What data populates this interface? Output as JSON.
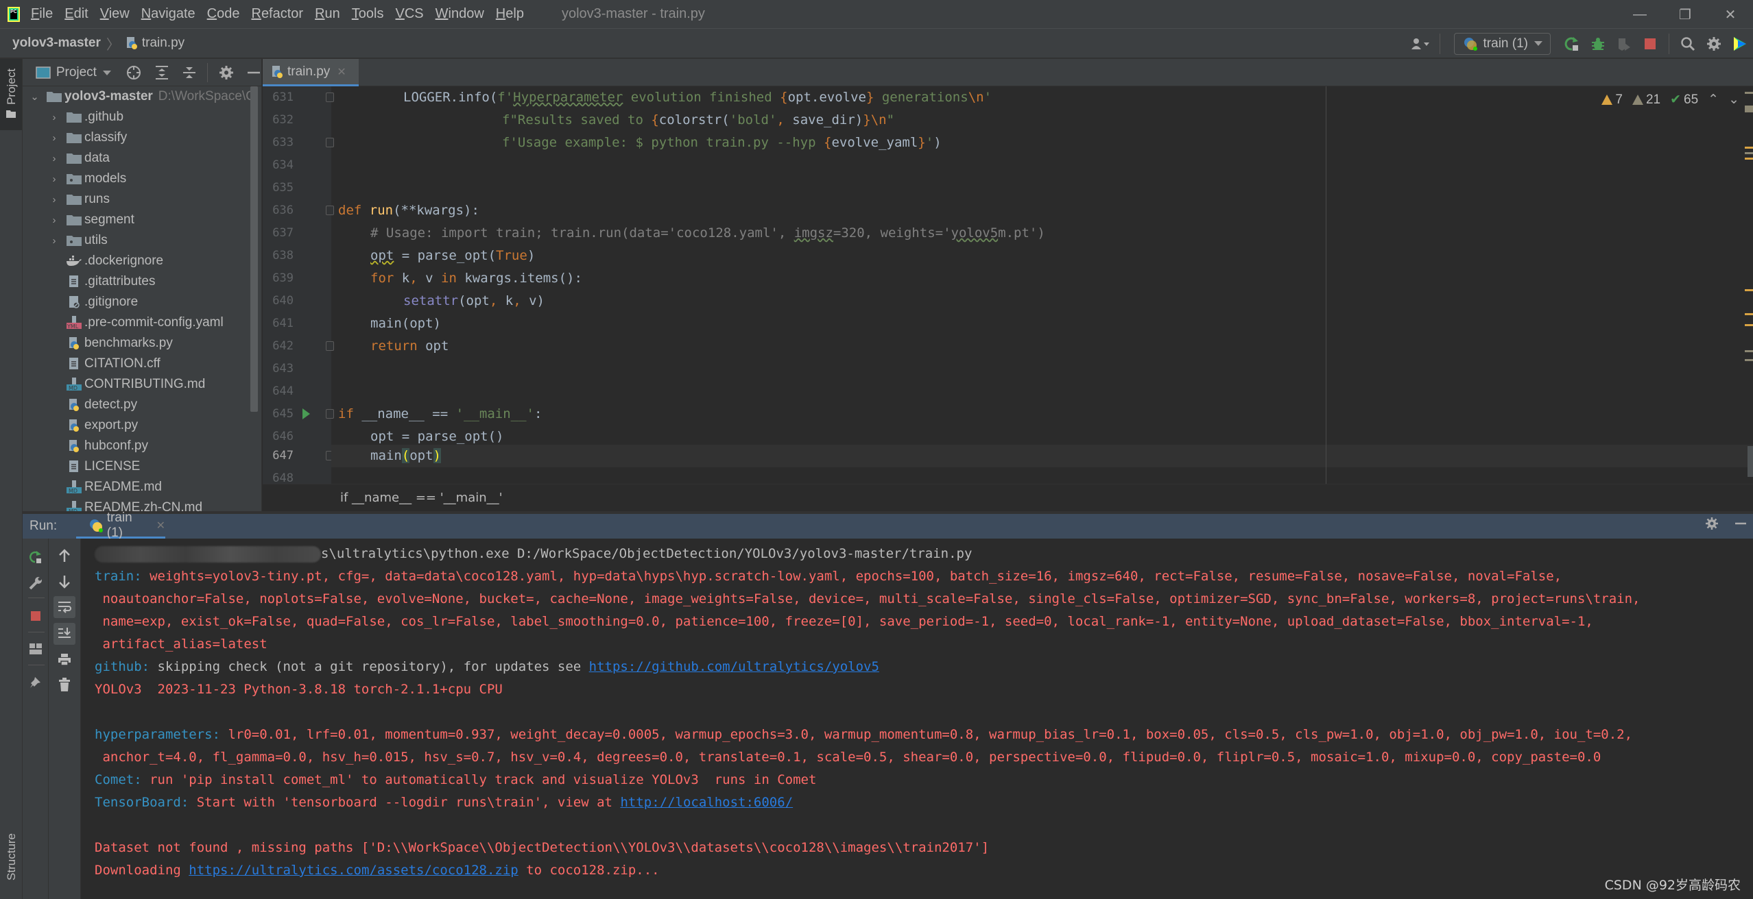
{
  "app": {
    "logo_text": "PC",
    "window_title": "yolov3-master - train.py",
    "menu": [
      {
        "label": "File",
        "mnemonic": "F",
        "rest": "ile"
      },
      {
        "label": "Edit",
        "mnemonic": "E",
        "rest": "dit"
      },
      {
        "label": "View",
        "mnemonic": "V",
        "rest": "iew"
      },
      {
        "label": "Navigate",
        "mnemonic": "N",
        "rest": "avigate"
      },
      {
        "label": "Code",
        "mnemonic": "C",
        "rest": "ode"
      },
      {
        "label": "Refactor",
        "mnemonic": "R",
        "rest": "efactor"
      },
      {
        "label": "Run",
        "mnemonic": "R",
        "rest": "un"
      },
      {
        "label": "Tools",
        "mnemonic": "T",
        "rest": "ools"
      },
      {
        "label": "VCS",
        "mnemonic": "V",
        "rest": "CS"
      },
      {
        "label": "Window",
        "mnemonic": "W",
        "rest": "indow"
      },
      {
        "label": "Help",
        "mnemonic": "H",
        "rest": "elp"
      }
    ],
    "window_controls": {
      "minimize": "—",
      "restore": "❐",
      "close": "✕"
    }
  },
  "navbar": {
    "project": "yolov3-master",
    "separator": "〉",
    "file": "train.py",
    "run_config": "train (1)"
  },
  "left_stripe": {
    "project_tab": "Project",
    "structure_tab": "Structure"
  },
  "project_panel": {
    "title": "Project",
    "root": {
      "name": "yolov3-master",
      "path": "D:\\WorkSpace\\O"
    },
    "items": [
      {
        "name": ".github",
        "type": "folder",
        "expandable": true
      },
      {
        "name": "classify",
        "type": "folder",
        "expandable": true
      },
      {
        "name": "data",
        "type": "folder",
        "expandable": true
      },
      {
        "name": "models",
        "type": "package",
        "expandable": true
      },
      {
        "name": "runs",
        "type": "folder",
        "expandable": true
      },
      {
        "name": "segment",
        "type": "folder",
        "expandable": true
      },
      {
        "name": "utils",
        "type": "package",
        "expandable": true
      },
      {
        "name": ".dockerignore",
        "type": "docker",
        "expandable": false
      },
      {
        "name": ".gitattributes",
        "type": "text",
        "expandable": false
      },
      {
        "name": ".gitignore",
        "type": "ignore",
        "expandable": false
      },
      {
        "name": ".pre-commit-config.yaml",
        "type": "yaml",
        "expandable": false
      },
      {
        "name": "benchmarks.py",
        "type": "python",
        "expandable": false
      },
      {
        "name": "CITATION.cff",
        "type": "text",
        "expandable": false
      },
      {
        "name": "CONTRIBUTING.md",
        "type": "markdown",
        "expandable": false
      },
      {
        "name": "detect.py",
        "type": "python",
        "expandable": false
      },
      {
        "name": "export.py",
        "type": "python",
        "expandable": false
      },
      {
        "name": "hubconf.py",
        "type": "python",
        "expandable": false
      },
      {
        "name": "LICENSE",
        "type": "text",
        "expandable": false
      },
      {
        "name": "README.md",
        "type": "markdown",
        "expandable": false
      },
      {
        "name": "README.zh-CN.md",
        "type": "markdown",
        "expandable": false
      }
    ]
  },
  "editor": {
    "tab": "train.py",
    "inspections": {
      "warnings": "7",
      "weak_warnings": "21",
      "typos": "65"
    },
    "line_numbers": [
      "631",
      "632",
      "633",
      "634",
      "635",
      "636",
      "637",
      "638",
      "639",
      "640",
      "641",
      "642",
      "643",
      "644",
      "645",
      "646",
      "647",
      "648"
    ],
    "current_line": "647",
    "code": {
      "l631": {
        "a": "LOGGER.info(",
        "b": "f'",
        "c": "Hyperparameter",
        "d": " evolution finished ",
        "e": "{",
        "f": "opt.evolve",
        "g": "}",
        "h": " generations",
        "i": "\\n",
        "j": "'"
      },
      "l632": {
        "a": "f\"Results saved to ",
        "b": "{",
        "c": "colorstr(",
        "d": "'bold'",
        "e": ", ",
        "f": "save_dir)",
        "g": "}",
        "h": "\\n",
        "i": "\""
      },
      "l633": {
        "a": "f'Usage example: $ python train.py --hyp ",
        "b": "{",
        "c": "evolve_yaml",
        "d": "}",
        "e": "'",
        "f": ")"
      },
      "l636": {
        "kw": "def",
        "fn": "run",
        "rest": "(**kwargs):"
      },
      "l637": {
        "a": "# Usage: import train; train.run(data='coco128.yaml', ",
        "b": "imgsz",
        "c": "=320, weights='",
        "d": "yolov5",
        "e": "m.pt')"
      },
      "l638": {
        "a": "opt",
        "b": " = parse_opt(",
        "c": "True",
        "d": ")"
      },
      "l639": {
        "kw1": "for",
        "a": " k",
        "comma1": ",",
        "b": " v ",
        "kw2": "in",
        "c": " kwargs.items():"
      },
      "l640": {
        "bi": "setattr",
        "a": "(opt",
        "c1": ",",
        "b": " k",
        "c2": ",",
        "c": " v)"
      },
      "l641": {
        "a": "main(opt)"
      },
      "l642": {
        "kw": "return",
        "a": " opt"
      },
      "l645": {
        "kw": "if",
        "a": " __name__ == ",
        "str": "'__main__'",
        "b": ":"
      },
      "l646": {
        "a": "opt = parse_opt()"
      },
      "l647": {
        "a": "main",
        "open": "(",
        "b": "opt",
        "close": ")"
      }
    },
    "breadcrumb": "if __name__ == '__main__'"
  },
  "run_panel": {
    "label": "Run:",
    "tab": "train (1)",
    "console": [
      {
        "kind": "cmd",
        "text": "s\\ultralytics\\python.exe D:/WorkSpace/ObjectDetection/YOLOv3/yolov3-master/train.py"
      },
      {
        "kind": "prefixed",
        "prefix": "train:",
        "text": " weights=yolov3-tiny.pt, cfg=, data=data\\coco128.yaml, hyp=data\\hyps\\hyp.scratch-low.yaml, epochs=100, batch_size=16, imgsz=640, rect=False, resume=False, nosave=False, noval=False,"
      },
      {
        "kind": "red",
        "text": " noautoanchor=False, noplots=False, evolve=None, bucket=, cache=None, image_weights=False, device=, multi_scale=False, single_cls=False, optimizer=SGD, sync_bn=False, workers=8, project=runs\\train,"
      },
      {
        "kind": "red",
        "text": " name=exp, exist_ok=False, quad=False, cos_lr=False, label_smoothing=0.0, patience=100, freeze=[0], save_period=-1, seed=0, local_rank=-1, entity=None, upload_dataset=False, bbox_interval=-1,"
      },
      {
        "kind": "red",
        "text": " artifact_alias=latest"
      },
      {
        "kind": "github",
        "prefix": "github:",
        "text": " skipping check (not a git repository), for updates see ",
        "link": "https://github.com/ultralytics/yolov5"
      },
      {
        "kind": "red",
        "text": "YOLOv3  2023-11-23 Python-3.8.18 torch-2.1.1+cpu CPU"
      },
      {
        "kind": "blank",
        "text": ""
      },
      {
        "kind": "prefixed",
        "prefix": "hyperparameters:",
        "text": " lr0=0.01, lrf=0.01, momentum=0.937, weight_decay=0.0005, warmup_epochs=3.0, warmup_momentum=0.8, warmup_bias_lr=0.1, box=0.05, cls=0.5, cls_pw=1.0, obj=1.0, obj_pw=1.0, iou_t=0.2,"
      },
      {
        "kind": "red",
        "text": " anchor_t=4.0, fl_gamma=0.0, hsv_h=0.015, hsv_s=0.7, hsv_v=0.4, degrees=0.0, translate=0.1, scale=0.5, shear=0.0, perspective=0.0, flipud=0.0, fliplr=0.5, mosaic=1.0, mixup=0.0, copy_paste=0.0"
      },
      {
        "kind": "prefixed",
        "prefix": "Comet:",
        "text": " run 'pip install comet_ml' to automatically track and visualize YOLOv3  runs in Comet"
      },
      {
        "kind": "link_line",
        "prefix": "TensorBoard:",
        "text": " Start with 'tensorboard --logdir runs\\train', view at ",
        "link": "http://localhost:6006/"
      },
      {
        "kind": "blank",
        "text": ""
      },
      {
        "kind": "red",
        "text": "Dataset not found , missing paths ['D:\\\\WorkSpace\\\\ObjectDetection\\\\YOLOv3\\\\datasets\\\\coco128\\\\images\\\\train2017']"
      },
      {
        "kind": "download",
        "text": "Downloading ",
        "link": "https://ultralytics.com/assets/coco128.zip",
        "suffix": " to coco128.zip..."
      }
    ]
  },
  "watermark": "CSDN @92岁高龄码农",
  "colors": {
    "accent": "#4a88c7",
    "console_error": "#ff6b68",
    "console_prefix": "#3592c4",
    "link": "#287bde",
    "warning": "#d9a343",
    "run_green": "#499c54",
    "stop_red": "#c75450"
  }
}
